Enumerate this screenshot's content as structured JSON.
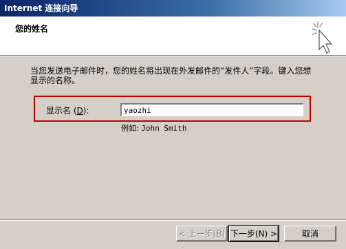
{
  "window": {
    "title": "Internet 连接向导"
  },
  "header": {
    "subtitle": "您的姓名",
    "icon": "wizard-sparkle-cursor-icon"
  },
  "body": {
    "description": "当您发送电子邮件时，您的姓名将出现在外发邮件的“发件人”字段。键入您想显示的名称。",
    "field_label_prefix": "显示名",
    "field_label_accel": "D",
    "display_name_value": "yaozhi",
    "example_prefix": "例如:",
    "example_name": "John Smith",
    "highlight_color": "#c00000"
  },
  "buttons": {
    "back": "< 上一步(B)",
    "next": "下一步(N) >",
    "cancel": "取消"
  }
}
